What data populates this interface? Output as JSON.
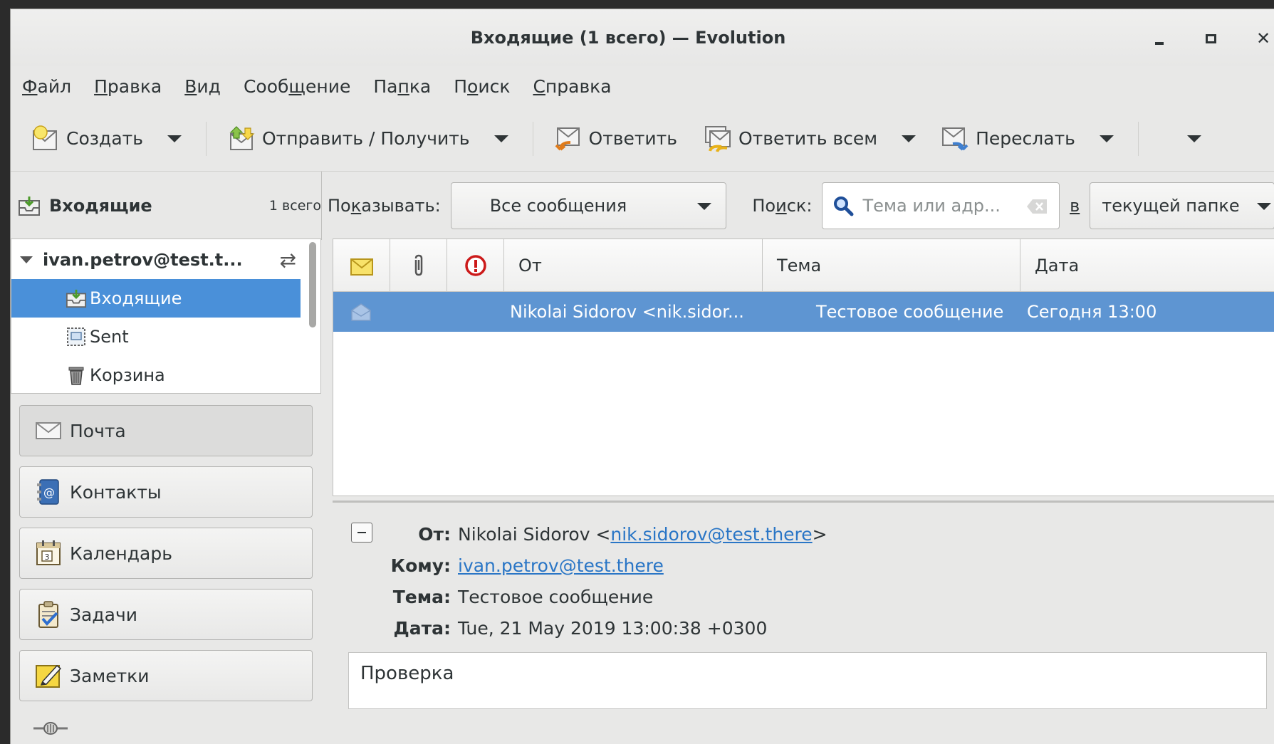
{
  "window": {
    "title": "Входящие (1 всего) — Evolution"
  },
  "menubar": {
    "items": [
      {
        "u": "Ф",
        "rest": "айл"
      },
      {
        "u": "П",
        "rest": "равка"
      },
      {
        "u": "В",
        "rest": "ид"
      },
      {
        "pre": "Сооб",
        "u": "щ",
        "rest": "ение"
      },
      {
        "pre": "Па",
        "u": "п",
        "rest": "ка"
      },
      {
        "pre": "П",
        "u": "о",
        "rest": "иск"
      },
      {
        "u": "С",
        "rest": "правка"
      }
    ]
  },
  "toolbar": {
    "create": "Создать",
    "send_receive": "Отправить / Получить",
    "reply": "Ответить",
    "reply_all": "Ответить всем",
    "forward": "Переслать"
  },
  "folder_header": {
    "name": "Входящие",
    "count": "1 всего"
  },
  "tree": {
    "account": "ivan.petrov@test.t...",
    "folders": [
      "Входящие",
      "Sent",
      "Корзина"
    ]
  },
  "switcher": {
    "mail": "Почта",
    "contacts": "Контакты",
    "calendar": "Календарь",
    "tasks": "Задачи",
    "notes": "Заметки"
  },
  "filter": {
    "show_pre": "По",
    "show_u": "к",
    "show_rest": "азывать:",
    "show_value": "Все сообщения",
    "search_pre": "По",
    "search_u": "и",
    "search_rest": "ск:",
    "search_placeholder": "Тема или адр...",
    "in_label": "в",
    "scope_value": "текущей папке"
  },
  "msglist": {
    "columns": {
      "from": "От",
      "subject": "Тема",
      "date": "Дата"
    },
    "rows": [
      {
        "from": "Nikolai Sidorov <nik.sidor...",
        "subject": "Тестовое сообщение",
        "date": "Сегодня 13:00"
      }
    ]
  },
  "preview": {
    "labels": {
      "from": "От:",
      "to": "Кому:",
      "subject": "Тема:",
      "date": "Дата:"
    },
    "from_name": "Nikolai Sidorov <",
    "from_email": "nik.sidorov@test.there",
    "from_close": ">",
    "to_email": "ivan.petrov@test.there",
    "subject": "Тестовое сообщение",
    "date": "Tue, 21 May 2019 13:00:38 +0300",
    "body": "Проверка"
  },
  "colors": {
    "selection": "#4a90d9",
    "row_selection": "#5e95d2",
    "link": "#2a76c6"
  }
}
